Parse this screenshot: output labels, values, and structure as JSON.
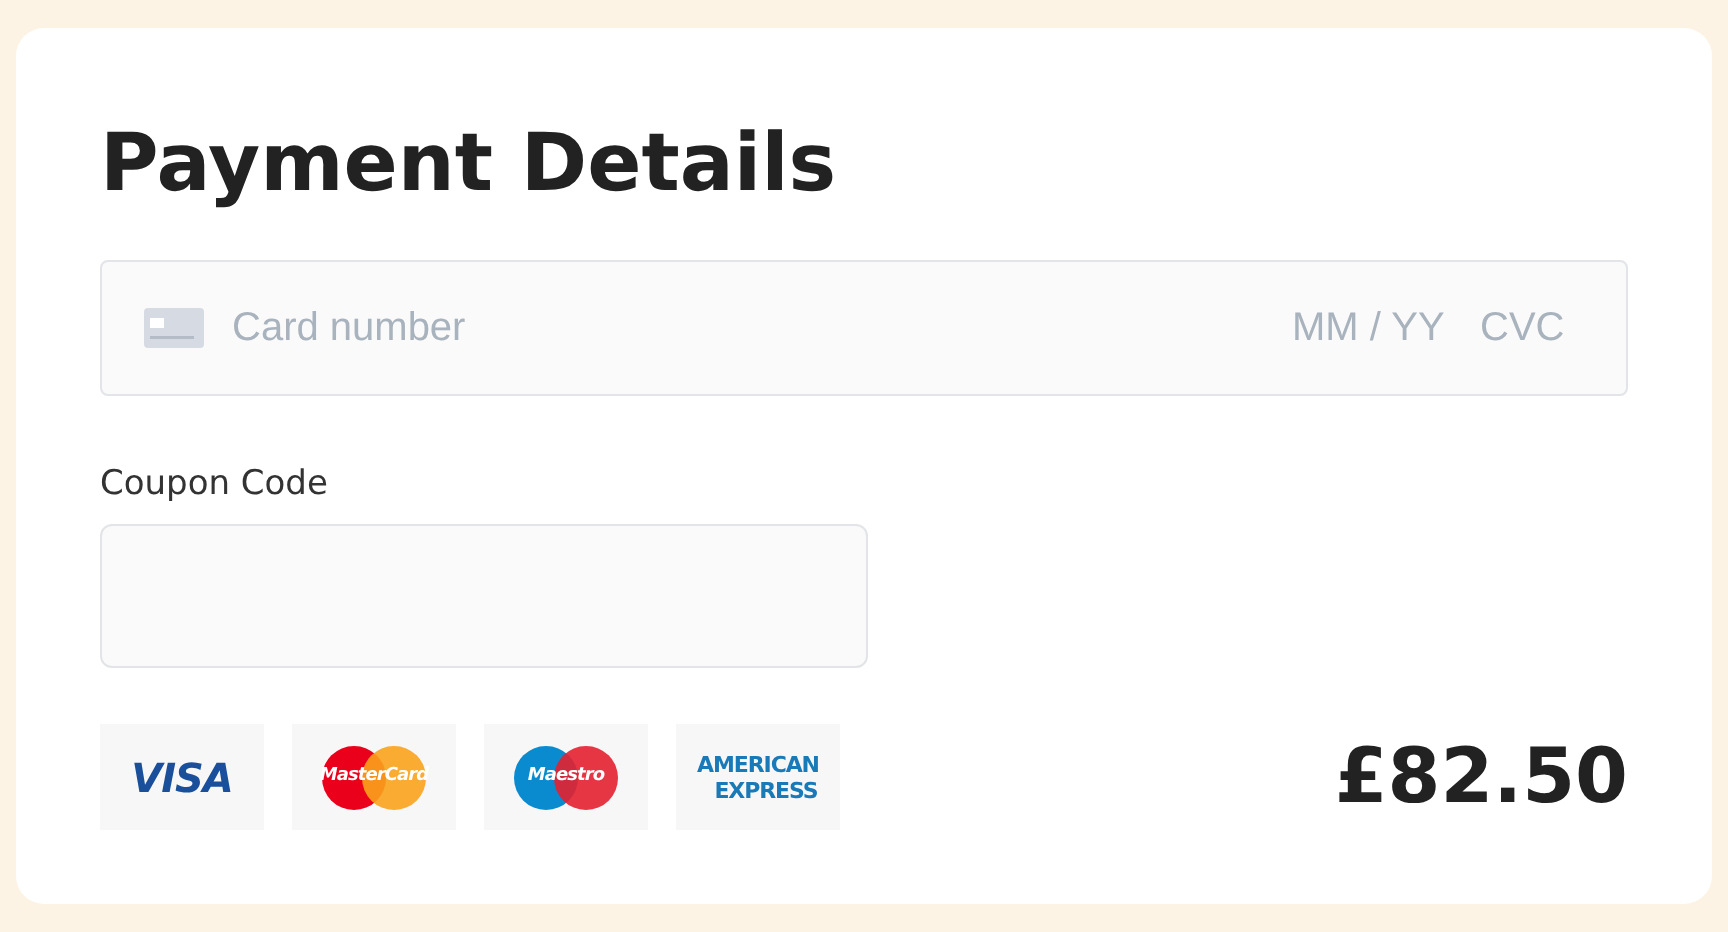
{
  "title": "Payment Details",
  "card_field": {
    "placeholder": "Card number",
    "expiry_placeholder": "MM / YY",
    "cvc_placeholder": "CVC"
  },
  "coupon": {
    "label": "Coupon Code"
  },
  "card_logos": [
    {
      "kind": "visa",
      "text": "VISA"
    },
    {
      "kind": "mastercard",
      "text": "MasterCard"
    },
    {
      "kind": "maestro",
      "text": "Maestro"
    },
    {
      "kind": "amex",
      "text": "AMERICAN",
      "text_2": "EXPRESS"
    }
  ],
  "total": "£82.50"
}
